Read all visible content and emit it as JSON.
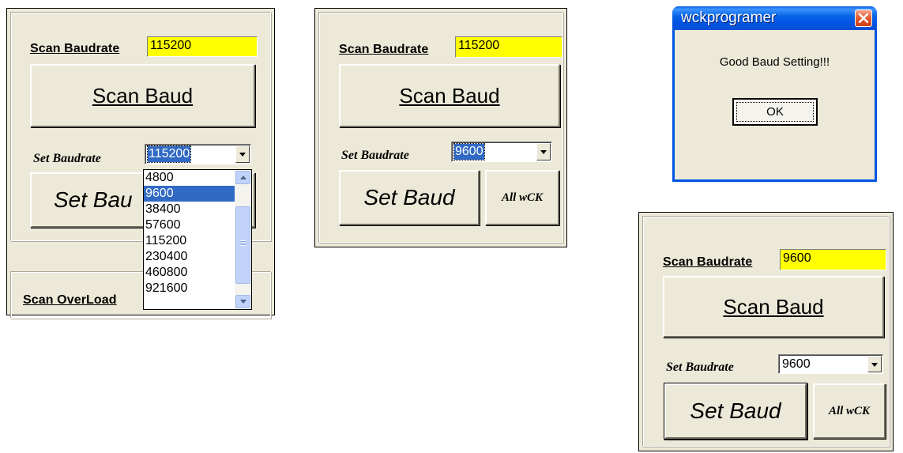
{
  "panel1": {
    "scan_label": "Scan Baudrate",
    "scan_value": "115200",
    "scan_button": "Scan Baud",
    "set_label": "Set Baudrate",
    "set_value": "115200",
    "set_button": "Set Bau",
    "overload_label": "Scan OverLoad",
    "dropdown_options": [
      "4800",
      "9600",
      "38400",
      "57600",
      "115200",
      "230400",
      "460800",
      "921600"
    ],
    "dropdown_highlighted": "9600"
  },
  "panel2": {
    "scan_label": "Scan Baudrate",
    "scan_value": "115200",
    "scan_button": "Scan Baud",
    "set_label": "Set Baudrate",
    "set_value": "9600",
    "set_button": "Set Baud",
    "all_button": "All wCK"
  },
  "dialog": {
    "title": "wckprogramer",
    "message": "Good Baud Setting!!!",
    "ok_button": "OK"
  },
  "panel3": {
    "scan_label": "Scan Baudrate",
    "scan_value": "9600",
    "scan_button": "Scan Baud",
    "set_label": "Set Baudrate",
    "set_value": "9600",
    "set_button": "Set Baud",
    "all_button": "All wCK"
  },
  "colors": {
    "panel_bg": "#ece9d8",
    "field_yellow": "#ffff00",
    "selection_blue": "#316ac5",
    "xp_title_blue": "#0054e3",
    "close_red": "#e35b2f"
  },
  "icons": {
    "dialog_close": "close-x-icon",
    "combo_arrow": "chevron-down-icon",
    "scroll_up": "scroll-up-arrow-icon",
    "scroll_down": "scroll-down-arrow-icon"
  }
}
